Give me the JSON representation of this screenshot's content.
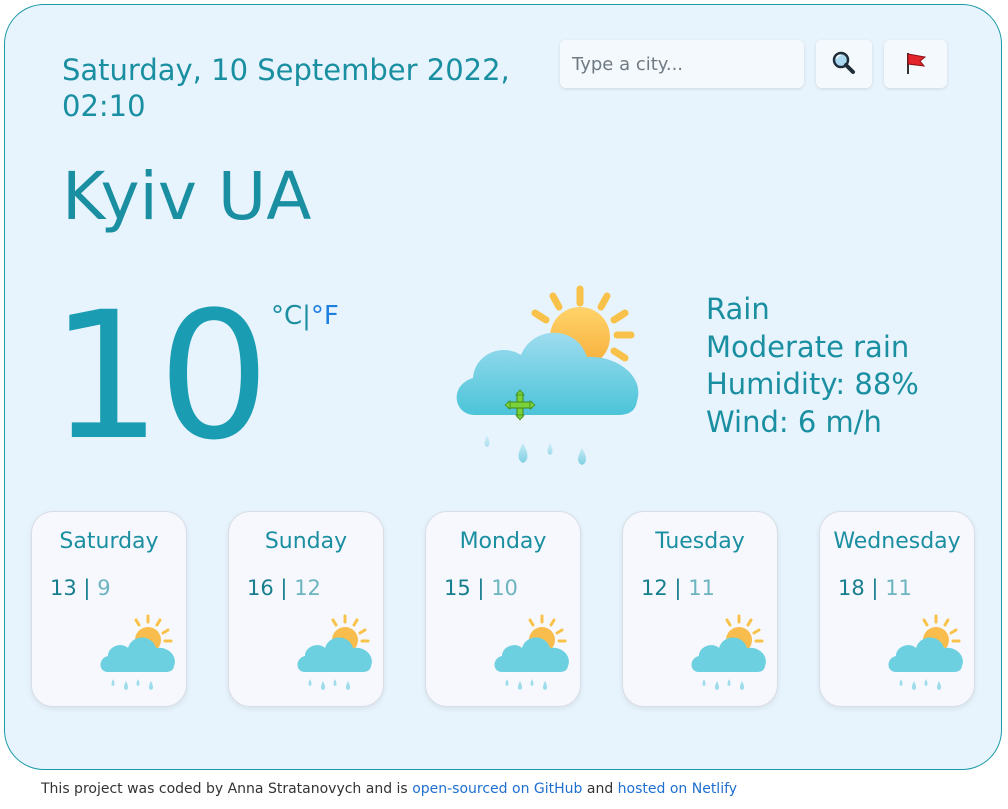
{
  "header": {
    "date": "Saturday, 10 September 2022, 02:10"
  },
  "search": {
    "placeholder": "Type a city..."
  },
  "buttons": {
    "search_icon": "magnifying-glass",
    "location_icon": "red-flag"
  },
  "current": {
    "city": "Kyiv UA",
    "temperature": "10",
    "unit_celsius": "°C",
    "unit_separator": "|",
    "unit_fahrenheit": "°F",
    "description": "Rain",
    "detail": "Moderate rain",
    "humidity": "Humidity: 88%",
    "wind": "Wind: 6 m/h",
    "icon": "sun-cloud-rain"
  },
  "forecast": [
    {
      "day": "Saturday",
      "max": "13",
      "separator": "|",
      "min": "9",
      "icon": "sun-cloud-rain"
    },
    {
      "day": "Sunday",
      "max": "16",
      "separator": "|",
      "min": "12",
      "icon": "sun-cloud-rain"
    },
    {
      "day": "Monday",
      "max": "15",
      "separator": "|",
      "min": "10",
      "icon": "sun-cloud-rain"
    },
    {
      "day": "Tuesday",
      "max": "12",
      "separator": "|",
      "min": "11",
      "icon": "sun-cloud-rain"
    },
    {
      "day": "Wednesday",
      "max": "18",
      "separator": "|",
      "min": "11",
      "icon": "sun-cloud-rain"
    }
  ],
  "footer": {
    "text_1": "This project was coded by Anna Stratanovych and is ",
    "link_github": "open-sourced on GitHub",
    "text_2": " and ",
    "link_netlify": "hosted on Netlify"
  },
  "colors": {
    "accent": "#1a8fa1",
    "fahrenheit_link": "#1e7fe0",
    "background": "#e8f4fd",
    "card": "#f7f8fd"
  }
}
